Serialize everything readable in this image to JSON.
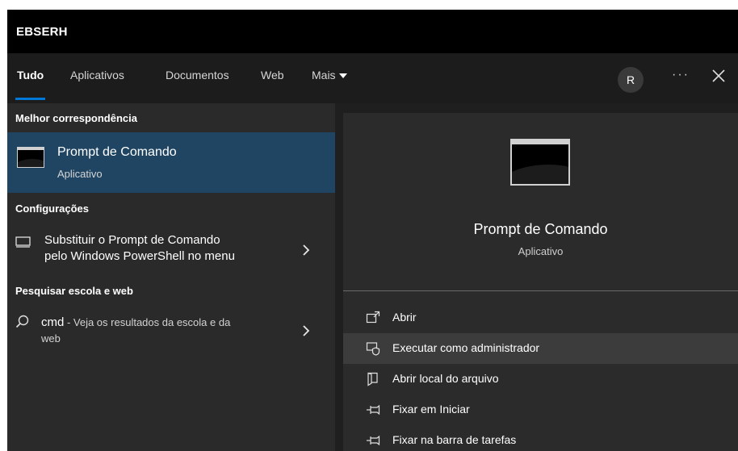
{
  "window": {
    "org": "EBSERH"
  },
  "tabs": [
    {
      "label": "Tudo"
    },
    {
      "label": "Aplicativos"
    },
    {
      "label": "Documentos"
    },
    {
      "label": "Web"
    },
    {
      "label": "Mais"
    }
  ],
  "user": {
    "initial": "R"
  },
  "more_label": "···",
  "best_match": {
    "header": "Melhor correspondência",
    "title": "Prompt de Comando",
    "subtitle": "Aplicativo"
  },
  "settings": {
    "header": "Configurações",
    "item_line1": "Substituir o Prompt de Comando",
    "item_line2": "pelo Windows PowerShell no menu"
  },
  "web_search": {
    "header": "Pesquisar escola e web",
    "query": "cmd",
    "suffix": " - Veja os resultados da escola e da",
    "suffix2": "web"
  },
  "preview": {
    "title": "Prompt de Comando",
    "subtitle": "Aplicativo"
  },
  "actions": [
    {
      "label": "Abrir",
      "icon": "open-window-icon"
    },
    {
      "label": "Executar como administrador",
      "icon": "admin-shield-icon"
    },
    {
      "label": "Abrir local do arquivo",
      "icon": "file-location-icon"
    },
    {
      "label": "Fixar em Iniciar",
      "icon": "pin-icon"
    },
    {
      "label": "Fixar na barra de tarefas",
      "icon": "pin-icon"
    }
  ],
  "colors": {
    "accent": "#0078d7",
    "selected": "#1f4563",
    "hover": "#3c3c3c"
  }
}
